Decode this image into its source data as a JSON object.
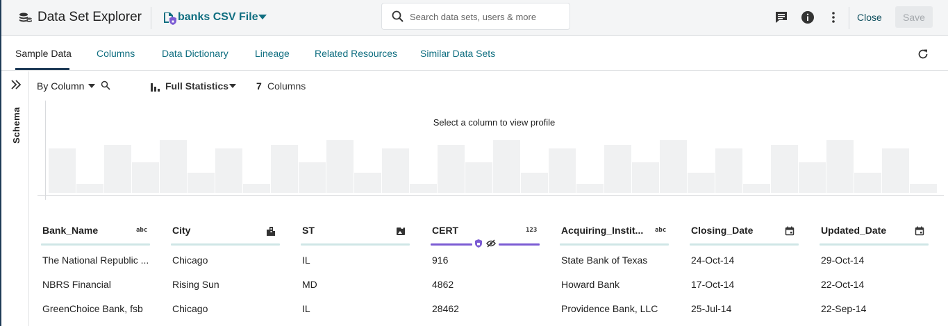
{
  "header": {
    "app_title": "Data Set Explorer",
    "dataset_name": "banks CSV File",
    "search_placeholder": "Search data sets, users & more",
    "close_label": "Close",
    "save_label": "Save"
  },
  "tabs": [
    {
      "label": "Sample Data",
      "active": true
    },
    {
      "label": "Columns"
    },
    {
      "label": "Data Dictionary"
    },
    {
      "label": "Lineage"
    },
    {
      "label": "Related Resources"
    },
    {
      "label": "Similar Data Sets"
    }
  ],
  "schema_label": "Schema",
  "toolbar": {
    "view_mode": "By Column",
    "stats_mode": "Full Statistics",
    "column_count": "7",
    "column_word": "Columns"
  },
  "profile": {
    "message": "Select a column to view profile",
    "placeholder_levels": [
      0.8,
      0.16,
      0.86,
      0.55,
      0.95,
      0.36,
      0.8,
      0.16,
      0.86,
      0.55,
      0.95,
      0.36,
      0.8,
      0.16,
      0.86,
      0.55,
      0.95,
      0.36,
      0.8,
      0.16,
      0.86,
      0.55,
      0.95,
      0.36,
      0.8,
      0.16,
      0.86,
      0.55,
      0.95,
      0.36,
      0.8,
      0.16
    ]
  },
  "columns": [
    {
      "name": "Bank_Name",
      "type_icon": "text-type-icon",
      "type_label": "abc"
    },
    {
      "name": "City",
      "type_icon": "city-type-icon",
      "type_label": ""
    },
    {
      "name": "ST",
      "type_icon": "geo-type-icon",
      "type_label": ""
    },
    {
      "name": "CERT",
      "type_icon": "number-type-icon",
      "type_label": "123",
      "selected": true
    },
    {
      "name": "Acquiring_Instit...",
      "type_icon": "text-type-icon",
      "type_label": "abc"
    },
    {
      "name": "Closing_Date",
      "type_icon": "calendar-icon",
      "type_label": ""
    },
    {
      "name": "Updated_Date",
      "type_icon": "calendar-icon",
      "type_label": ""
    }
  ],
  "rows": [
    [
      "The National Republic ...",
      "Chicago",
      "IL",
      "916",
      "State Bank of Texas",
      "24-Oct-14",
      "29-Oct-14"
    ],
    [
      "NBRS Financial",
      "Rising Sun",
      "MD",
      "4862",
      "Howard Bank",
      "17-Oct-14",
      "22-Oct-14"
    ],
    [
      "GreenChoice Bank, fsb",
      "Chicago",
      "IL",
      "28462",
      "Providence Bank, LLC",
      "25-Jul-14",
      "22-Sep-14"
    ]
  ],
  "colors": {
    "accent": "#0f6e80",
    "selected_column": "#7b5bd3",
    "column_underline": "#cfe6e6",
    "nav_dark": "#1f3b57"
  }
}
